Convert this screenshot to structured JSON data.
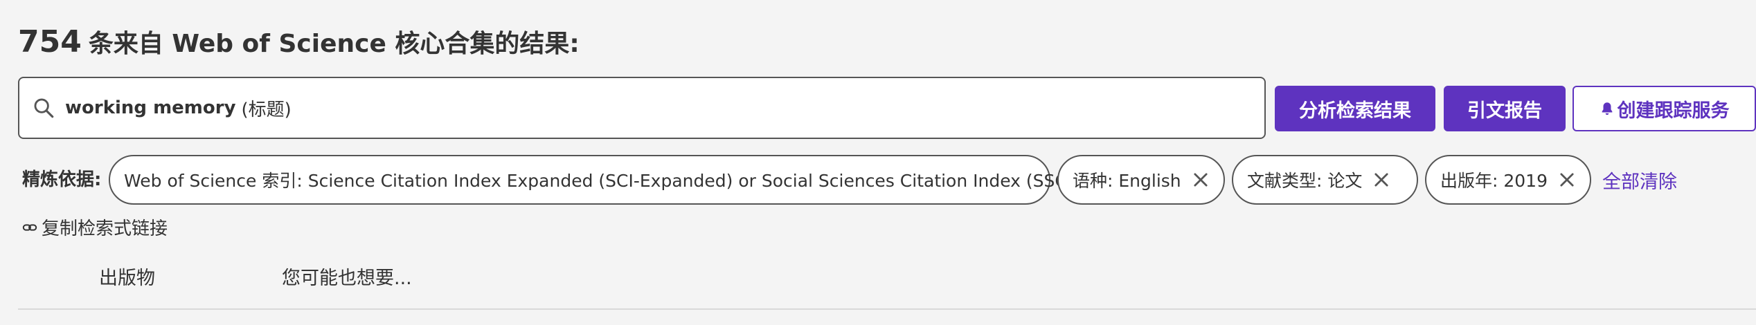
{
  "header": {
    "result_count": "754",
    "result_text": "条来自 Web of Science 核心合集的结果:"
  },
  "search": {
    "term": "working memory",
    "field": "(标题)",
    "icon": "search-icon"
  },
  "actions": {
    "analyze_label": "分析检索结果",
    "citation_report_label": "引文报告",
    "create_alert_label": "创建跟踪服务"
  },
  "refine": {
    "label": "精炼依据:",
    "chips": [
      {
        "label": "Web of Science 索引: Science Citation Index Expanded (SCI-Expanded) or Social Sciences Citation Index (SSCI)"
      },
      {
        "label": "语种: English"
      },
      {
        "label": "文献类型: 论文"
      },
      {
        "label": "出版年: 2019"
      }
    ],
    "clear_all_label": "全部清除"
  },
  "copy_link": {
    "label": "复制检索式链接",
    "icon": "link-icon"
  },
  "tabs": [
    {
      "label": "出版物"
    },
    {
      "label": "您可能也想要..."
    }
  ],
  "colors": {
    "accent": "#5e33bf",
    "background": "#f4f4f4",
    "text": "#333333"
  }
}
